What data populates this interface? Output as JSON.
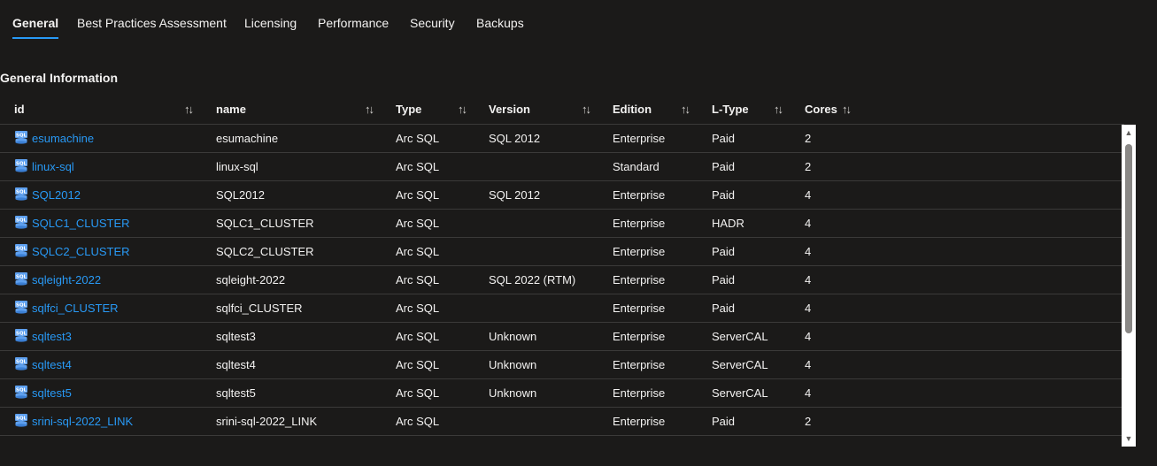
{
  "tabs": [
    {
      "label": "General",
      "active": true
    },
    {
      "label": "Best Practices Assessment",
      "active": false
    },
    {
      "label": "Licensing",
      "active": false
    },
    {
      "label": "Performance",
      "active": false
    },
    {
      "label": "Security",
      "active": false
    },
    {
      "label": "Backups",
      "active": false
    }
  ],
  "section_title": "General Information",
  "columns": [
    "id",
    "name",
    "Type",
    "Version",
    "Edition",
    "L-Type",
    "Cores"
  ],
  "sort_glyph": "↑↓",
  "icon": "sql-database-icon",
  "colors": {
    "link": "#2899f5",
    "background": "#1b1a19",
    "divider": "#3b3a39"
  },
  "rows": [
    {
      "id": "esumachine",
      "name": "esumachine",
      "type": "Arc SQL",
      "version": "SQL 2012",
      "edition": "Enterprise",
      "ltype": "Paid",
      "cores": "2"
    },
    {
      "id": "linux-sql",
      "name": "linux-sql",
      "type": "Arc SQL",
      "version": "",
      "edition": "Standard",
      "ltype": "Paid",
      "cores": "2"
    },
    {
      "id": "SQL2012",
      "name": "SQL2012",
      "type": "Arc SQL",
      "version": "SQL 2012",
      "edition": "Enterprise",
      "ltype": "Paid",
      "cores": "4"
    },
    {
      "id": "SQLC1_CLUSTER",
      "name": "SQLC1_CLUSTER",
      "type": "Arc SQL",
      "version": "",
      "edition": "Enterprise",
      "ltype": "HADR",
      "cores": "4"
    },
    {
      "id": "SQLC2_CLUSTER",
      "name": "SQLC2_CLUSTER",
      "type": "Arc SQL",
      "version": "",
      "edition": "Enterprise",
      "ltype": "Paid",
      "cores": "4"
    },
    {
      "id": "sqleight-2022",
      "name": "sqleight-2022",
      "type": "Arc SQL",
      "version": "SQL 2022 (RTM)",
      "edition": "Enterprise",
      "ltype": "Paid",
      "cores": "4"
    },
    {
      "id": "sqlfci_CLUSTER",
      "name": "sqlfci_CLUSTER",
      "type": "Arc SQL",
      "version": "",
      "edition": "Enterprise",
      "ltype": "Paid",
      "cores": "4"
    },
    {
      "id": "sqltest3",
      "name": "sqltest3",
      "type": "Arc SQL",
      "version": "Unknown",
      "edition": "Enterprise",
      "ltype": "ServerCAL",
      "cores": "4"
    },
    {
      "id": "sqltest4",
      "name": "sqltest4",
      "type": "Arc SQL",
      "version": "Unknown",
      "edition": "Enterprise",
      "ltype": "ServerCAL",
      "cores": "4"
    },
    {
      "id": "sqltest5",
      "name": "sqltest5",
      "type": "Arc SQL",
      "version": "Unknown",
      "edition": "Enterprise",
      "ltype": "ServerCAL",
      "cores": "4"
    },
    {
      "id": "srini-sql-2022_LINK",
      "name": "srini-sql-2022_LINK",
      "type": "Arc SQL",
      "version": "",
      "edition": "Enterprise",
      "ltype": "Paid",
      "cores": "2"
    }
  ],
  "scrollbar": {
    "up": "▲",
    "down": "▼"
  }
}
